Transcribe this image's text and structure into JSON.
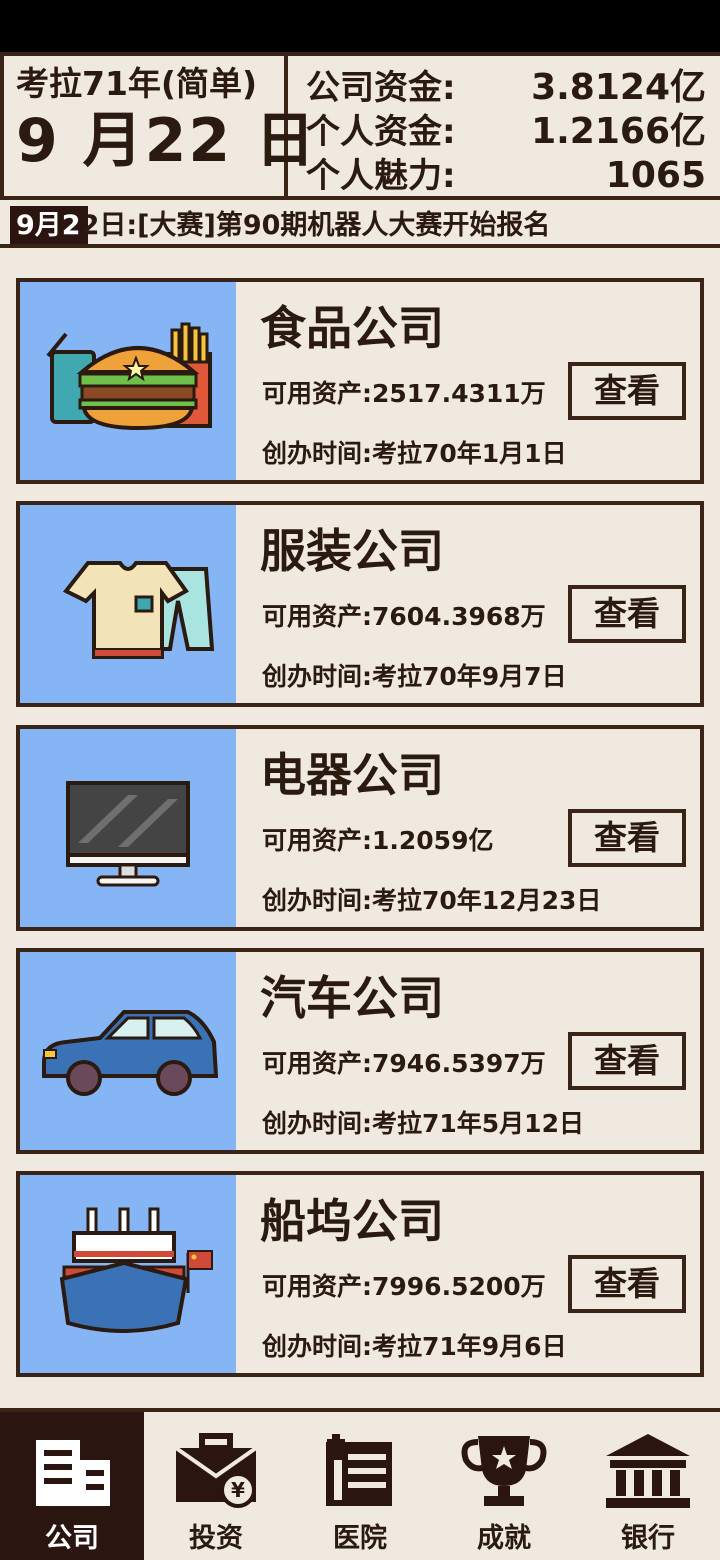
{
  "header": {
    "year_label": "考拉71年(简单)",
    "date": "9 月22 日",
    "stats": [
      {
        "label": "公司资金:",
        "value": "3.8124亿"
      },
      {
        "label": "个人资金:",
        "value": "1.2166亿"
      },
      {
        "label": "个人魅力:",
        "value": "1065"
      }
    ]
  },
  "ticker": {
    "prefix": "9月2",
    "text": "2日:[大赛]第90期机器人大赛开始报名"
  },
  "companies": [
    {
      "name": "食品公司",
      "assets": "可用资产:2517.4311万",
      "founded": "创办时间:考拉70年1月1日",
      "button": "查看",
      "icon": "food-icon"
    },
    {
      "name": "服装公司",
      "assets": "可用资产:7604.3968万",
      "founded": "创办时间:考拉70年9月7日",
      "button": "查看",
      "icon": "clothing-icon"
    },
    {
      "name": "电器公司",
      "assets": "可用资产:1.2059亿",
      "founded": "创办时间:考拉70年12月23日",
      "button": "查看",
      "icon": "monitor-icon"
    },
    {
      "name": "汽车公司",
      "assets": "可用资产:7946.5397万",
      "founded": "创办时间:考拉71年5月12日",
      "button": "查看",
      "icon": "car-icon"
    },
    {
      "name": "船坞公司",
      "assets": "可用资产:7996.5200万",
      "founded": "创办时间:考拉71年9月6日",
      "button": "查看",
      "icon": "ship-icon"
    }
  ],
  "nav": [
    {
      "label": "公司",
      "icon": "company-building-icon",
      "active": true
    },
    {
      "label": "投资",
      "icon": "briefcase-icon",
      "active": false
    },
    {
      "label": "医院",
      "icon": "hospital-icon",
      "active": false
    },
    {
      "label": "成就",
      "icon": "trophy-icon",
      "active": false
    },
    {
      "label": "银行",
      "icon": "bank-icon",
      "active": false
    }
  ],
  "colors": {
    "background": "#efe9df",
    "thumb": "#85b5f5",
    "dark": "#2a1510"
  }
}
